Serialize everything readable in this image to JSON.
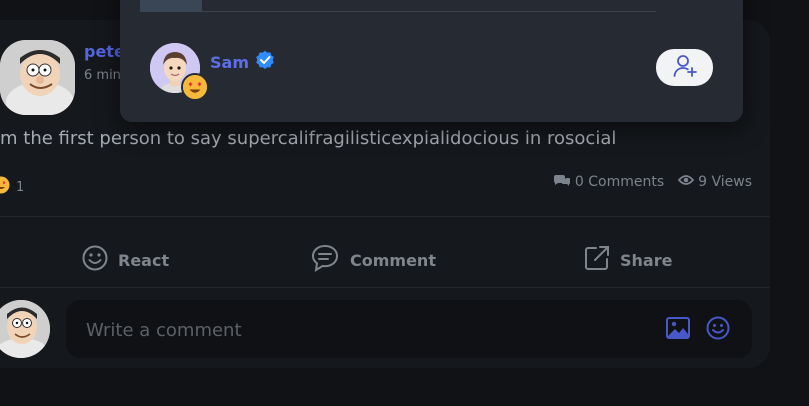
{
  "post": {
    "author": "pete",
    "time": "6 min",
    "text": "m the first person to say supercalifragilisticexpialidocious in rosocial",
    "reaction_count": "1",
    "comments": "0 Comments",
    "views": "9 Views"
  },
  "actions": {
    "react": "React",
    "comment": "Comment",
    "share": "Share"
  },
  "comment_box": {
    "placeholder": "Write a comment"
  },
  "popup": {
    "user_name": "Sam",
    "progress": 0.12
  },
  "colors": {
    "accent": "#5566e0",
    "verified": "#2f8cff",
    "card_bg": "#15181c",
    "popup_bg": "#262b33"
  },
  "icons": {
    "verified": "verified-badge-icon",
    "follow": "add-user-icon",
    "comments": "comments-icon",
    "views": "eye-icon",
    "react": "smiley-icon",
    "comment": "comment-bubble-icon",
    "share": "share-icon",
    "image": "image-icon",
    "emoji": "emoji-icon"
  }
}
